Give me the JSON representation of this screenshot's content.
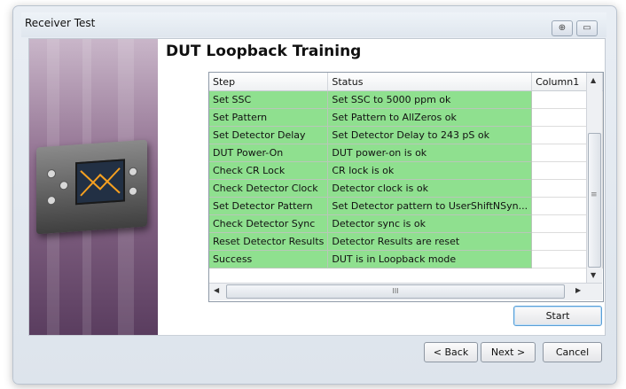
{
  "window": {
    "title": "Receiver Test",
    "icons": [
      "help-icon",
      "restore-icon"
    ]
  },
  "page": {
    "heading": "DUT Loopback Training"
  },
  "table": {
    "columns": [
      "Step",
      "Status",
      "Column1"
    ],
    "rows": [
      {
        "step": "Set SSC",
        "status": "Set SSC to 5000 ppm ok",
        "col1": ""
      },
      {
        "step": "Set Pattern",
        "status": "Set Pattern to AllZeros ok",
        "col1": ""
      },
      {
        "step": "Set Detector Delay",
        "status": "Set Detector Delay to 243 pS ok",
        "col1": ""
      },
      {
        "step": "DUT Power-On",
        "status": "DUT power-on is ok",
        "col1": ""
      },
      {
        "step": "Check CR Lock",
        "status": "CR lock is ok",
        "col1": ""
      },
      {
        "step": "Check Detector Clock",
        "status": "Detector clock is ok",
        "col1": ""
      },
      {
        "step": "Set Detector Pattern",
        "status": "Set Detector pattern to UserShiftNSyn...",
        "col1": ""
      },
      {
        "step": "Check Detector Sync",
        "status": "Detector sync is ok",
        "col1": ""
      },
      {
        "step": "Reset Detector Results",
        "status": "Detector Results are reset",
        "col1": ""
      },
      {
        "step": "Success",
        "status": "DUT is in Loopback mode",
        "col1": ""
      }
    ],
    "row_color": "#8fe08f",
    "hscroll_grip": "III",
    "vscroll_grip": "≡"
  },
  "buttons": {
    "start": "Start",
    "back": "< Back",
    "next": "Next >",
    "cancel": "Cancel"
  }
}
